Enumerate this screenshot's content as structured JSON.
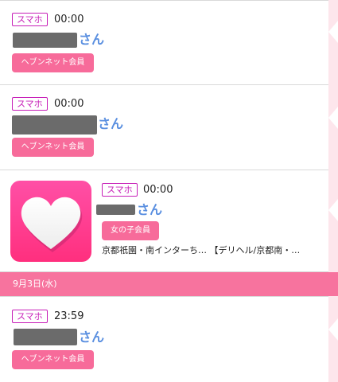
{
  "entries": [
    {
      "device": "スマホ",
      "time": "00:00",
      "name_suffix": "さん",
      "member_type": "ヘブンネット会員"
    },
    {
      "device": "スマホ",
      "time": "00:00",
      "name_suffix": "さん",
      "member_type": "ヘブンネット会員"
    },
    {
      "device": "スマホ",
      "time": "00:00",
      "name_suffix": "さん",
      "member_type": "女の子会員",
      "description": "京都祇園・南インターち… 【デリヘル/京都南・…"
    },
    {
      "device": "スマホ",
      "time": "23:59",
      "name_suffix": "さん",
      "member_type": "ヘブンネット会員"
    }
  ],
  "date_header": "9月3日(水)",
  "colors": {
    "badge_border": "#c71fb8",
    "pill_bg": "#f76b9a",
    "date_bar_bg": "#f7739e",
    "name_suffix": "#5a8fe0",
    "thumb_gradient": [
      "#ff4fa6",
      "#ff2f7e"
    ]
  },
  "icons": {
    "avatar": "heart-icon"
  }
}
